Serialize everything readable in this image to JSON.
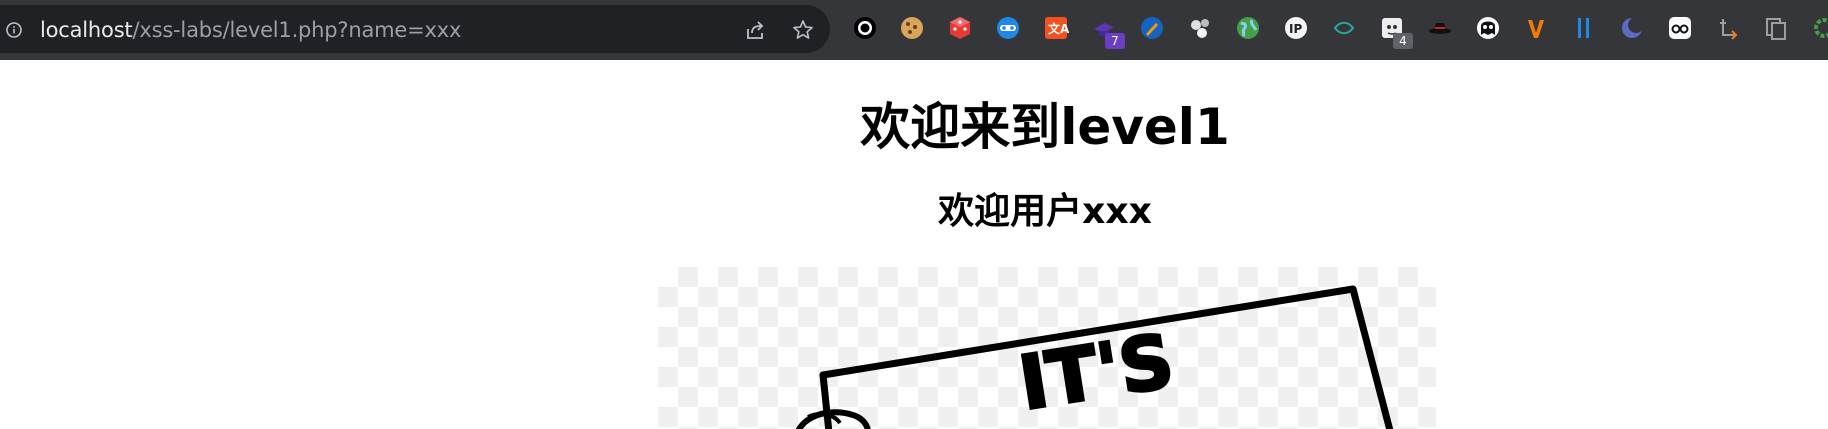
{
  "browser": {
    "url_host": "localhost",
    "url_path": "/xss-labs/level1.php?name=xxx",
    "extensions": [
      {
        "name": "circle-extension-icon"
      },
      {
        "name": "cookie-extension-icon"
      },
      {
        "name": "dice-extension-icon"
      },
      {
        "name": "mask-extension-icon"
      },
      {
        "name": "translate-extension-icon"
      },
      {
        "name": "hat-extension-icon",
        "badge": "7",
        "badge_color": "#6a3fc6"
      },
      {
        "name": "pen-extension-icon"
      },
      {
        "name": "dots-extension-icon"
      },
      {
        "name": "globe-extension-icon"
      },
      {
        "name": "ip-extension-icon",
        "label": "IP"
      },
      {
        "name": "fish-extension-icon"
      },
      {
        "name": "cat-extension-icon",
        "badge": "4",
        "badge_color": "#5f6368"
      },
      {
        "name": "spy-hat-extension-icon"
      },
      {
        "name": "ghost-extension-icon"
      },
      {
        "name": "wappalyzer-extension-icon"
      },
      {
        "name": "bars-extension-icon"
      },
      {
        "name": "moon-extension-icon"
      },
      {
        "name": "glasses-extension-icon"
      },
      {
        "name": "arrow-extension-icon"
      },
      {
        "name": "copy-extension-icon"
      },
      {
        "name": "gear-extension-icon"
      }
    ]
  },
  "page": {
    "heading": "欢迎来到level1",
    "subheading": "欢迎用户xxx",
    "image_text": "IT'S"
  }
}
